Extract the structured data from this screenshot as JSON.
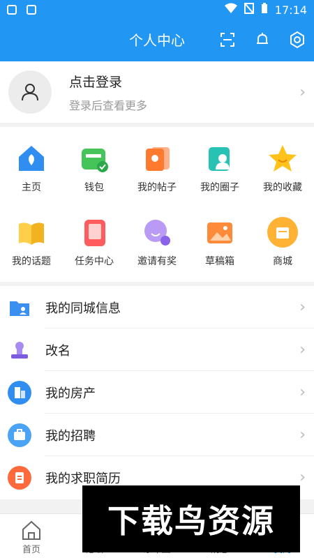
{
  "status_bar": {
    "time": "17:14"
  },
  "header": {
    "title": "个人中心"
  },
  "profile": {
    "login": "点击登录",
    "hint": "登录后查看更多"
  },
  "grid": [
    {
      "label": "主页",
      "icon": "home-icon"
    },
    {
      "label": "钱包",
      "icon": "wallet-icon"
    },
    {
      "label": "我的帖子",
      "icon": "posts-icon"
    },
    {
      "label": "我的圈子",
      "icon": "circle-icon"
    },
    {
      "label": "我的收藏",
      "icon": "star-icon"
    },
    {
      "label": "我的话题",
      "icon": "topic-icon"
    },
    {
      "label": "任务中心",
      "icon": "task-icon"
    },
    {
      "label": "邀请有奖",
      "icon": "invite-icon"
    },
    {
      "label": "草稿箱",
      "icon": "draft-icon"
    },
    {
      "label": "商城",
      "icon": "shop-icon"
    }
  ],
  "menu": [
    {
      "label": "我的同城信息",
      "icon": "folder-user-icon"
    },
    {
      "label": "改名",
      "icon": "stamp-icon"
    },
    {
      "label": "我的房产",
      "icon": "building-icon"
    },
    {
      "label": "我的招聘",
      "icon": "briefcase-icon"
    },
    {
      "label": "我的求职简历",
      "icon": "resume-icon"
    }
  ],
  "tabs": [
    {
      "label": "首页",
      "icon": "home-outline-icon"
    },
    {
      "label": "论坛",
      "icon": "forum-icon"
    },
    {
      "label": "东车圈",
      "icon": "car-circle-icon"
    },
    {
      "label": "消息",
      "icon": "message-icon"
    },
    {
      "label": "我的",
      "icon": "me-icon",
      "active": true
    }
  ],
  "watermark": {
    "text": "下载鸟资源"
  },
  "colors": {
    "primary": "#2196f3"
  }
}
